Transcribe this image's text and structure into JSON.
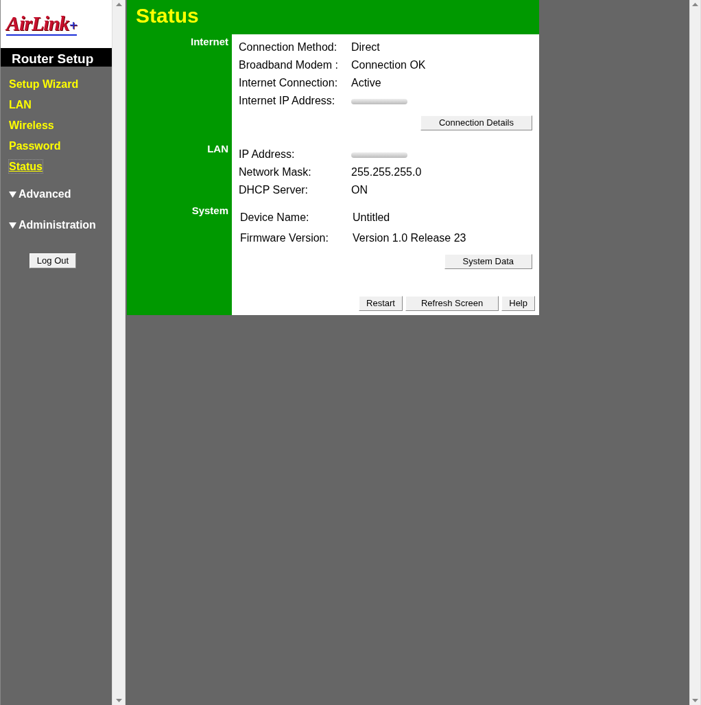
{
  "sidebar": {
    "logo": {
      "main": "AirLink",
      "plus": "+"
    },
    "title": "Router Setup",
    "items": [
      {
        "label": "Setup Wizard",
        "selected": false
      },
      {
        "label": "LAN",
        "selected": false
      },
      {
        "label": "Wireless",
        "selected": false
      },
      {
        "label": "Password",
        "selected": false
      },
      {
        "label": "Status",
        "selected": true
      }
    ],
    "groups": [
      {
        "label": "Advanced"
      },
      {
        "label": "Administration"
      }
    ],
    "logout": "Log Out"
  },
  "page": {
    "title": "Status",
    "sections": [
      {
        "label": "Internet",
        "rows": [
          {
            "label": "Connection Method:",
            "value": "Direct",
            "kind": "text"
          },
          {
            "label": "Broadband Modem :",
            "value": "Connection OK",
            "kind": "text"
          },
          {
            "label": "Internet Connection:",
            "value": "Active",
            "kind": "text"
          },
          {
            "label": "Internet IP Address:",
            "kind": "redacted"
          }
        ],
        "buttons": [
          "Connection Details"
        ]
      },
      {
        "label": "LAN",
        "rows": [
          {
            "label": "IP Address:",
            "kind": "redacted"
          },
          {
            "label": "Network Mask:",
            "value": "255.255.255.0",
            "kind": "text"
          },
          {
            "label": "DHCP Server:",
            "value": "ON",
            "kind": "text"
          }
        ]
      },
      {
        "label": "System",
        "rows": [
          {
            "label": "Device Name:",
            "value": "Untitled",
            "kind": "text"
          },
          {
            "label": "Firmware Version:",
            "value": "Version 1.0 Release 23",
            "kind": "text"
          }
        ],
        "buttons": [
          "System Data"
        ]
      }
    ],
    "footer_buttons": [
      "Restart",
      "Refresh Screen",
      "Help"
    ]
  }
}
